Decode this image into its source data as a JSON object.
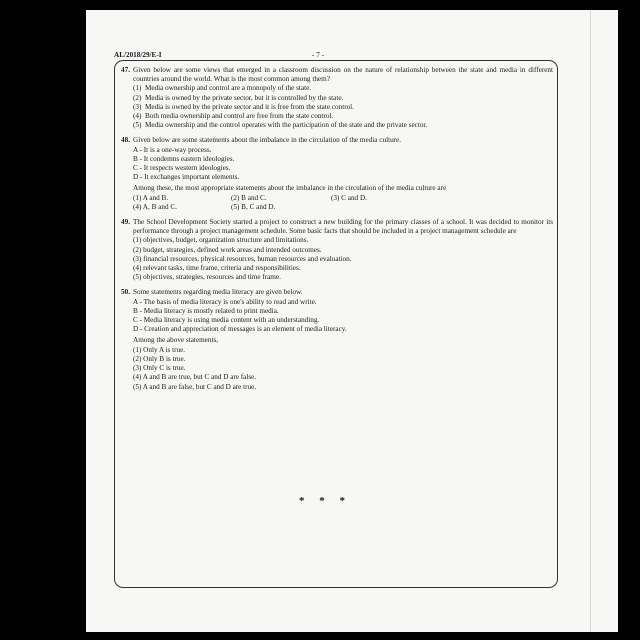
{
  "header": {
    "code": "AL/2018/29/E-I",
    "page": "- 7 -"
  },
  "questions": {
    "q47": {
      "number": "47.",
      "stem": "Given below are some views that emerged in a classroom discussion on the nature of relationship between the state and media in different countries around the world. What is the most common among them?",
      "options": [
        {
          "num": "(1)",
          "text": "Media ownership and control are a monopoly of the state."
        },
        {
          "num": "(2)",
          "text": "Media is owned by the private sector, but it is controlled by the state."
        },
        {
          "num": "(3)",
          "text": "Media is owned by the private sector and it is free from the state control."
        },
        {
          "num": "(4)",
          "text": "Both media ownership and control are free from the state control."
        },
        {
          "num": "(5)",
          "text": "Media ownership and the control operates with the participation of the state and the private sector."
        }
      ]
    },
    "q48": {
      "number": "48.",
      "stem": "Given below are some statements about the imbalance in the circulation of the media culture.",
      "statements": [
        "A  -  It is a one-way process.",
        "B  -  It condemns eastern ideologies.",
        "C  -  It respects western ideologies.",
        "D  -  It exchanges important elements."
      ],
      "stem2": "Among these, the most appropriate statements about the imbalance in the circulation of the media culture are",
      "options": [
        "(1) A and B.",
        "(2) B and C.",
        "(3) C and D.",
        "(4) A, B and C.",
        "(5) B, C and D."
      ]
    },
    "q49": {
      "number": "49.",
      "stem": "The School Development Society started a project to construct a new building for the primary classes of a school. It was decided to monitor its performance through a project management schedule. Some basic facts that should be included in a project management schedule are",
      "options": [
        "(1) objectives, budget, organization structure and limitations.",
        "(2) budget, strategies, defined work areas and intended outcomes.",
        "(3) financial resources, physical resources, human resources and evaluation.",
        "(4) relevant tasks, time frame, criteria and responsibilities.",
        "(5) objectives, strategies, resources and time frame."
      ]
    },
    "q50": {
      "number": "50.",
      "stem": "Some statements regarding media literacy are given below.",
      "statements": [
        "A  -  The basis of media literacy is one's ability to read and write.",
        "B  -  Media literacy is mostly related to print media.",
        "C  -  Media literacy is using media content with an understanding.",
        "D  -  Creation and appreciation of messages is an element of media literacy."
      ],
      "stem2": "Among the above statements,",
      "options": [
        "(1) Only A is true.",
        "(2) Only B is true.",
        "(3) Only C is true.",
        "(4) A and B are true, but C and D are false.",
        "(5) A and B are false, but C and D are true."
      ]
    }
  },
  "end_mark": "* * *"
}
